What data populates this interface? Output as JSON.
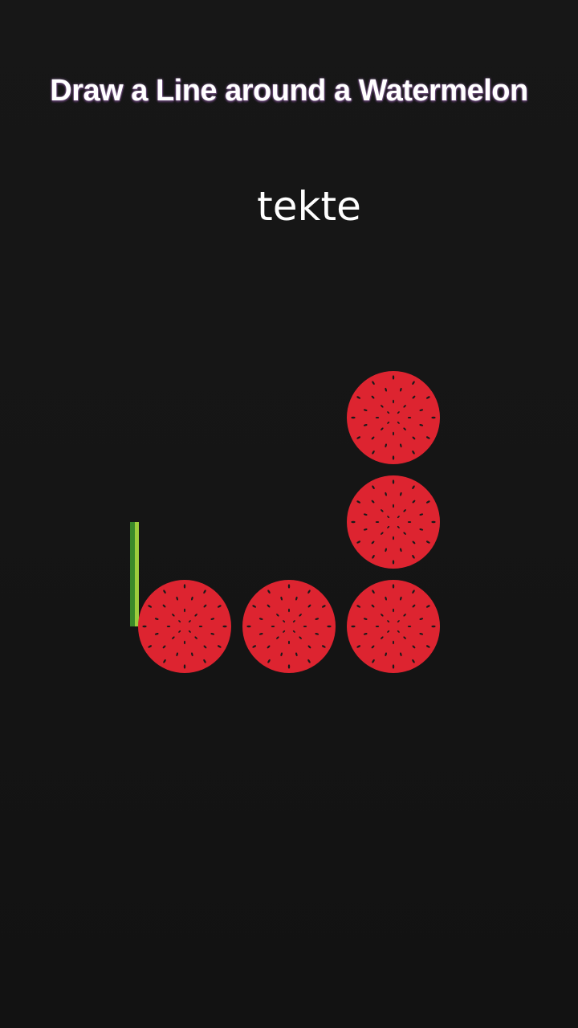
{
  "title": "Draw a Line around a Watermelon",
  "caption": "tekte",
  "colors": {
    "background": "#161616",
    "melon_flesh": "#dd2430",
    "melon_seed": "#1a1a1a",
    "line_dark": "#3b8a2a",
    "line_light": "#9ccc3c"
  },
  "game": {
    "melon_count": 5,
    "drawn_line": "vertical-green-stroke"
  }
}
